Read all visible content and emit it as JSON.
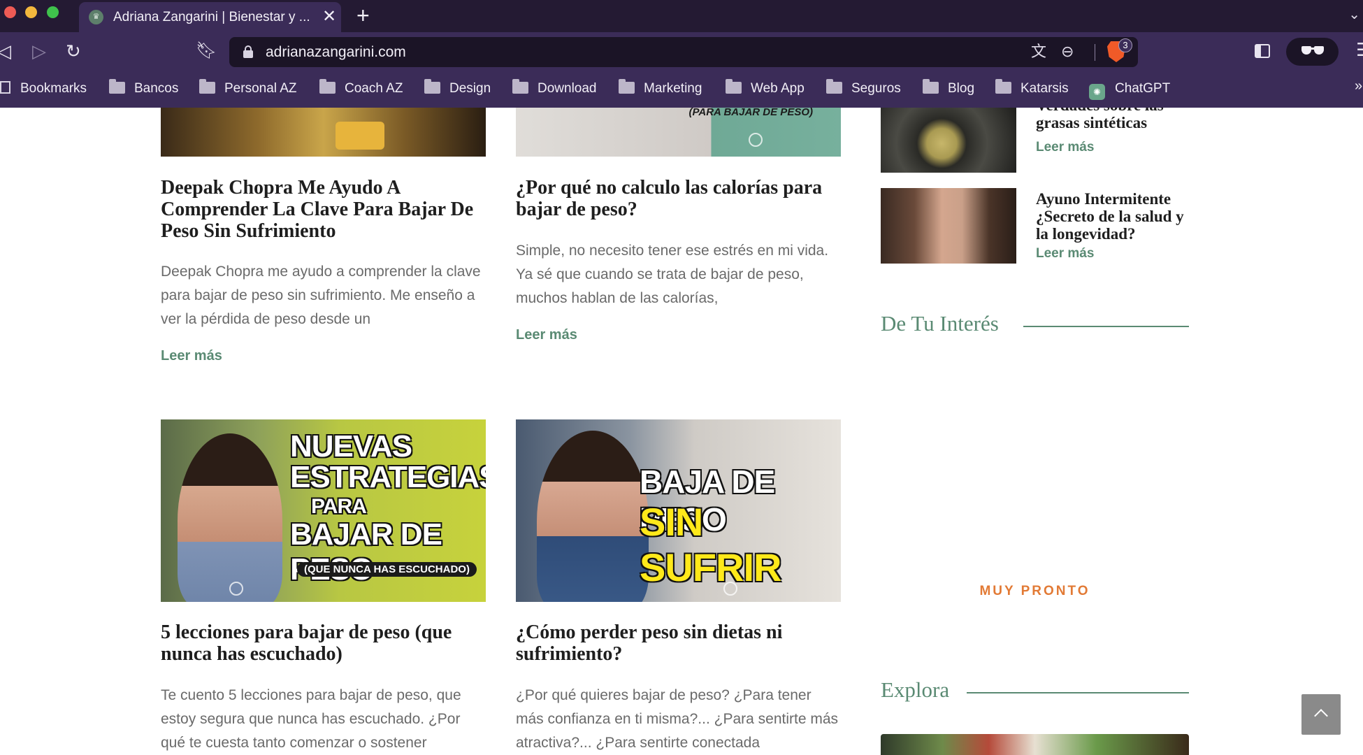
{
  "browser": {
    "tab_title": "Adriana Zangarini | Bienestar y ...",
    "url": "adrianazangarini.com",
    "brave_badge_count": "3",
    "bookmarks": [
      {
        "label": "Bookmarks"
      },
      {
        "label": "Bancos"
      },
      {
        "label": "Personal AZ"
      },
      {
        "label": "Coach AZ"
      },
      {
        "label": "Design"
      },
      {
        "label": "Download"
      },
      {
        "label": "Marketing"
      },
      {
        "label": "Web App"
      },
      {
        "label": "Seguros"
      },
      {
        "label": "Blog"
      },
      {
        "label": "Katarsis"
      },
      {
        "label": "ChatGPT"
      }
    ],
    "bookmarks_more": "»"
  },
  "posts": [
    {
      "title": "Deepak Chopra Me Ayudo A Comprender La Clave Para Bajar De Peso Sin Sufrimiento",
      "excerpt": "Deepak Chopra me ayudo a comprender la clave para bajar de peso sin sufrimiento. Me enseño a ver la pérdida de peso desde un",
      "read_more": "Leer más"
    },
    {
      "title": "¿Por qué no calculo las calorías para bajar de peso?",
      "excerpt": "Simple, no necesito tener ese estrés en mi vida. Ya sé que cuando se trata de bajar de peso, muchos hablan de las calorías,",
      "read_more": "Leer más",
      "thumb_banner": "(PARA BAJAR DE PESO)"
    },
    {
      "title": "5 lecciones para bajar de peso (que nunca has escuchado)",
      "excerpt": "Te cuento 5 lecciones para bajar de peso, que estoy segura que nunca has escuchado. ¿Por qué te cuesta tanto comenzar o sostener",
      "thumb_lines": [
        "NUEVAS",
        "ESTRATEGIAS",
        "PARA",
        "BAJAR DE PESO"
      ],
      "thumb_pill": "(QUE NUNCA HAS ESCUCHADO)"
    },
    {
      "title": "¿Cómo perder peso sin dietas ni sufrimiento?",
      "excerpt": "¿Por qué quieres bajar de peso? ¿Para tener más confianza en ti misma?... ¿Para sentirte más atractiva?... ¿Para sentirte conectada",
      "thumb_lines": [
        "BAJA DE PESO",
        "SIN SUFRIR"
      ]
    }
  ],
  "sidebar": {
    "recent": [
      {
        "title": "Verdades sobre las grasas sintéticas",
        "read_more": "Leer más"
      },
      {
        "title": "Ayuno Intermitente ¿Secreto de la salud y la longevidad?",
        "read_more": "Leer más"
      }
    ],
    "interest_heading": "De Tu Interés",
    "coming_soon": "MUY PRONTO",
    "explore_heading": "Explora"
  },
  "colors": {
    "brand_green": "#5a8a73",
    "accent_orange": "#e27a35",
    "chrome_purple": "#3b2c58"
  }
}
